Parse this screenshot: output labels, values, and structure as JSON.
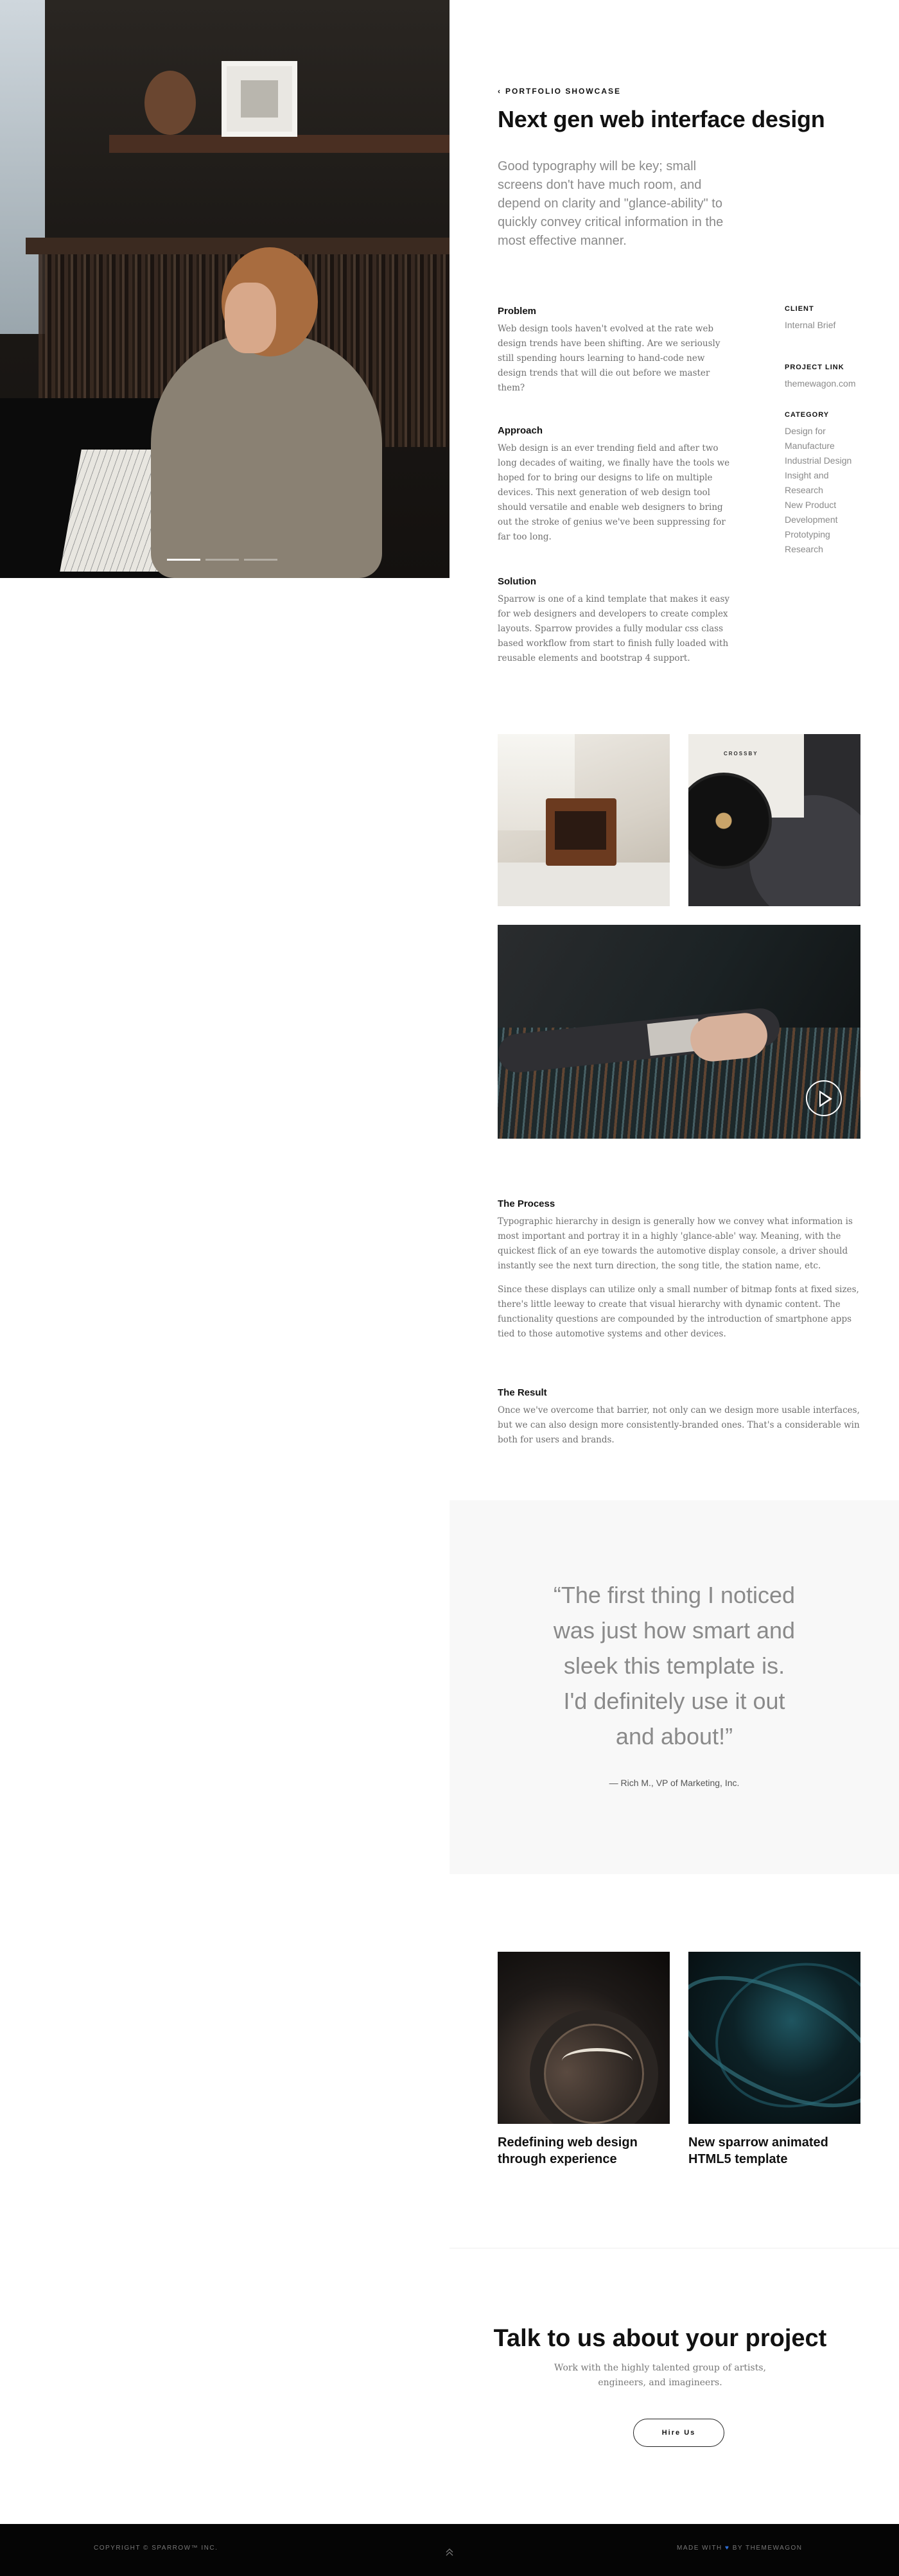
{
  "header": {
    "back_label": "Portfolio Showcase",
    "title": "Next gen web interface design",
    "lead": "Good typography will be key; small screens don't have much room, and depend on clarity and \"glance-ability\" to quickly convey critical information in the most effective manner."
  },
  "hero": {
    "slides": 3,
    "active_slide": 1
  },
  "sections": {
    "problem": {
      "title": "Problem",
      "text": "Web design tools haven't evolved at the rate web design trends have been shifting. Are we seriously still spending hours learning to hand-code new design trends that will die out before we master them?"
    },
    "approach": {
      "title": "Approach",
      "text": "Web design is an ever trending field and after two long decades of waiting, we finally have the tools we hoped for to bring our designs to life on multiple devices. This next generation of web design tool should versatile and enable web designers to bring out the stroke of genius we've been suppressing for far too long."
    },
    "solution": {
      "title": "Solution",
      "text": "Sparrow is one of a kind template that makes it easy for web designers and developers to create complex layouts. Sparrow provides a fully modular css class based workflow from start to finish fully loaded with reusable elements and bootstrap 4 support."
    }
  },
  "meta": {
    "client_label": "Client",
    "client_value": "Internal Brief",
    "link_label": "Project Link",
    "link_value": "themewagon.com",
    "category_label": "Category",
    "categories": [
      "Design for",
      "Manufacture",
      "Industrial Design",
      "Insight and",
      "Research",
      "New Product",
      "Development",
      "Prototyping",
      "Research"
    ]
  },
  "gallery": {
    "vinyl_sleeve_text": "CROSSBY"
  },
  "process": {
    "title": "The Process",
    "para1": "Typographic hierarchy in design is generally how we convey what information is most important and portray it in a highly 'glance-able' way. Meaning, with the quickest flick of an eye towards the automotive display console, a driver should instantly see the next turn direction, the song title, the station name, etc.",
    "para2": "Since these displays can utilize only a small number of bitmap fonts at fixed sizes, there's little leeway to create that visual hierarchy with dynamic content. The functionality questions are compounded by the introduction of smartphone apps tied to those automotive systems and other devices."
  },
  "result": {
    "title": "The Result",
    "text": "Once we've overcome that barrier, not only can we design more usable interfaces, but we can also design more consistently-branded ones. That's a considerable win both for users and brands."
  },
  "testimonial": {
    "quote": "“The first thing I noticed was just how smart and sleek this template is. I'd definitely use it out and about!”",
    "author": "— Rich M., VP of Marketing, Inc."
  },
  "related": [
    {
      "title": "Redefining web design through experience"
    },
    {
      "title": "New sparrow animated HTML5 template"
    }
  ],
  "cta": {
    "title": "Talk to us about your project",
    "subtitle": "Work with the highly talented group of artists, engineers, and imagineers.",
    "button": "Hire Us"
  },
  "footer": {
    "copyright": "Copyright © Sparrow™ Inc.",
    "made_with_prefix": "Made with",
    "heart": "♥",
    "made_with_by": "by",
    "brand": "ThemeWagon"
  },
  "colors": {
    "accent_heart": "#2f6fd6",
    "testimonial_bg": "#f8f8f8",
    "footer_bg": "#050505"
  },
  "icons": [
    "chevron-left-icon",
    "play-icon",
    "scroll-top-icon"
  ]
}
